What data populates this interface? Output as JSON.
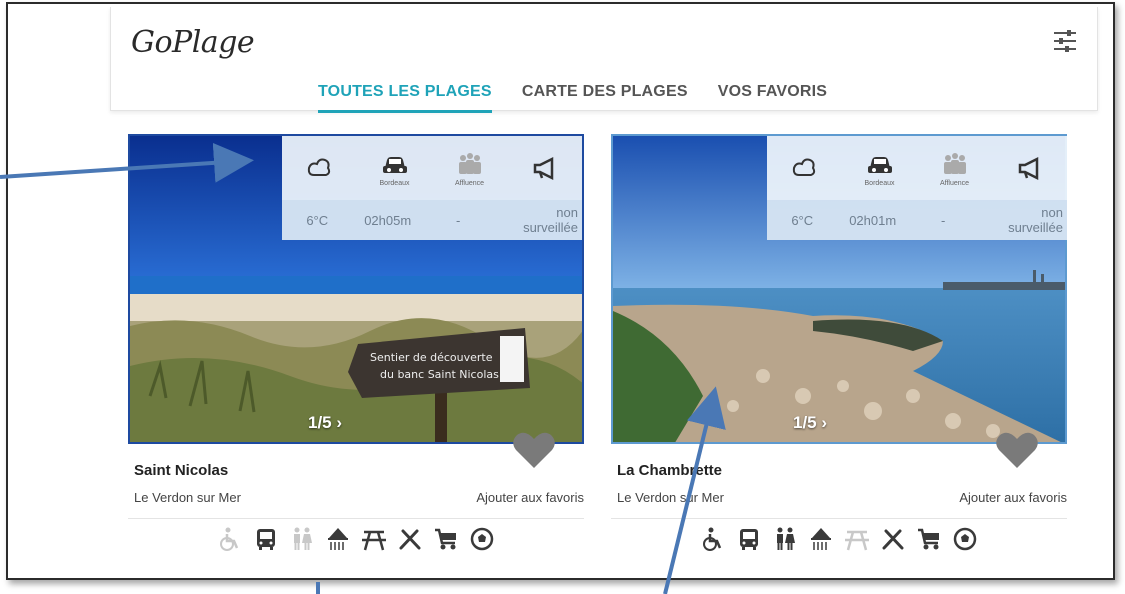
{
  "app": {
    "logo": "GoPlage"
  },
  "tabs": [
    {
      "label": "TOUTES LES PLAGES",
      "active": true
    },
    {
      "label": "CARTE DES PLAGES",
      "active": false
    },
    {
      "label": "VOS FAVORIS",
      "active": false
    }
  ],
  "info_labels": {
    "car": "Bordeaux",
    "crowd": "Affluence"
  },
  "beaches": [
    {
      "name": "Saint Nicolas",
      "town": "Le Verdon sur Mer",
      "photo_counter": "1/5 ›",
      "favorite_label": "Ajouter aux favoris",
      "temperature": "6°C",
      "drive_time": "02h05m",
      "crowd": "-",
      "surveillance_line1": "non",
      "surveillance_line2": "surveillée",
      "sign_text_1": "Sentier de découverte",
      "sign_text_2": "du banc Saint Nicolas",
      "amenities": [
        {
          "icon": "wheelchair-icon",
          "available": false
        },
        {
          "icon": "bus-icon",
          "available": true
        },
        {
          "icon": "toilets-icon",
          "available": false
        },
        {
          "icon": "shower-icon",
          "available": true
        },
        {
          "icon": "picnic-icon",
          "available": true
        },
        {
          "icon": "restaurant-icon",
          "available": true
        },
        {
          "icon": "shop-cart-icon",
          "available": true
        },
        {
          "icon": "ball-icon",
          "available": true
        }
      ]
    },
    {
      "name": "La Chambrette",
      "town": "Le Verdon sur Mer",
      "photo_counter": "1/5 ›",
      "favorite_label": "Ajouter aux favoris",
      "temperature": "6°C",
      "drive_time": "02h01m",
      "crowd": "-",
      "surveillance_line1": "non",
      "surveillance_line2": "surveillée",
      "amenities": [
        {
          "icon": "wheelchair-icon",
          "available": true
        },
        {
          "icon": "bus-icon",
          "available": true
        },
        {
          "icon": "toilets-icon",
          "available": true
        },
        {
          "icon": "shower-icon",
          "available": true
        },
        {
          "icon": "picnic-icon",
          "available": false
        },
        {
          "icon": "restaurant-icon",
          "available": true
        },
        {
          "icon": "shop-cart-icon",
          "available": true
        },
        {
          "icon": "ball-icon",
          "available": true
        }
      ]
    }
  ],
  "colors": {
    "accent": "#1fa3b8",
    "arrow": "#4a78b5",
    "icon_on": "#3a3a3a",
    "icon_off": "#c8c8c8"
  }
}
